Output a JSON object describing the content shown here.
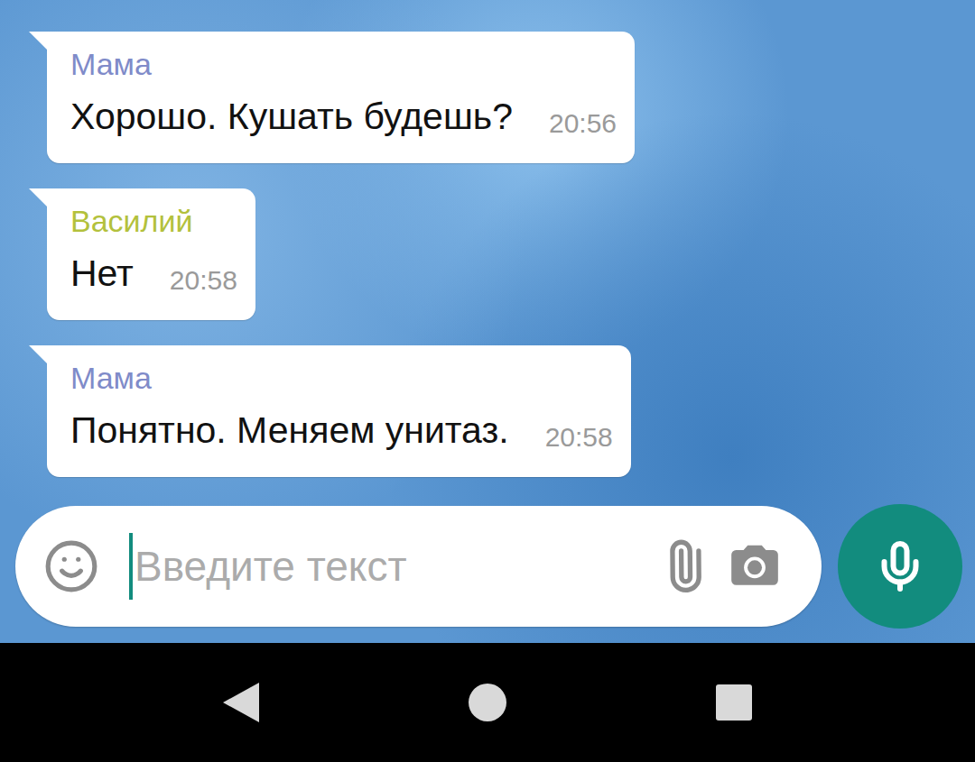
{
  "messages": [
    {
      "sender": "Мама",
      "color": "#7f8bc9",
      "text": "Хорошо. Кушать будешь?",
      "time": "20:56"
    },
    {
      "sender": "Василий",
      "color": "#b3c13c",
      "text": "Нет",
      "time": "20:58"
    },
    {
      "sender": "Мама",
      "color": "#7f8bc9",
      "text": "Понятно. Меняем унитаз.",
      "time": "20:58"
    }
  ],
  "input": {
    "placeholder": "Введите текст"
  }
}
